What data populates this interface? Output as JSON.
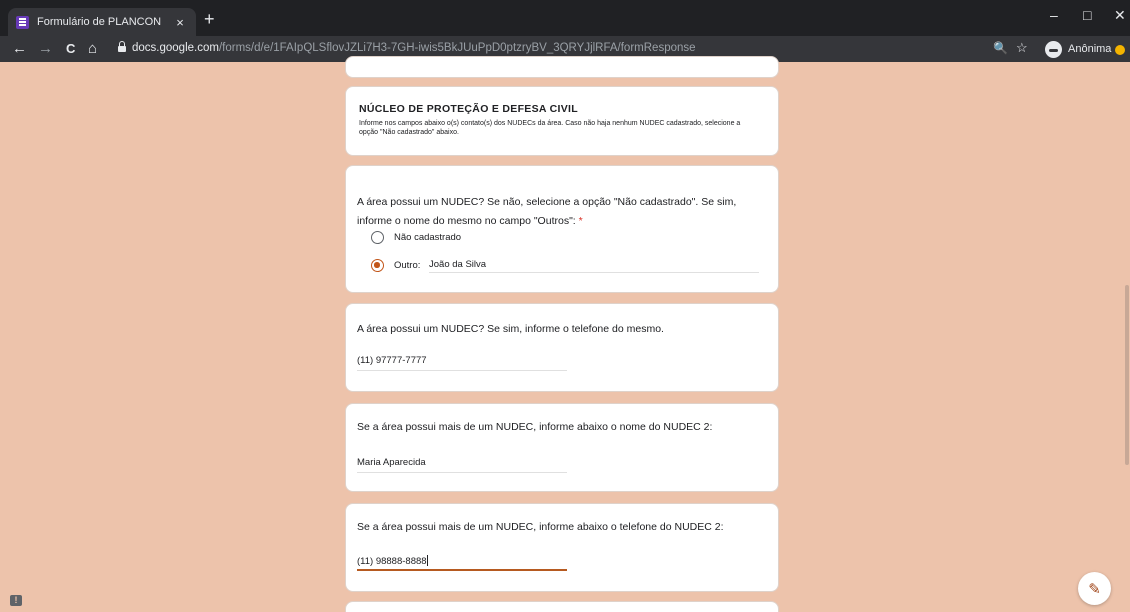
{
  "browser": {
    "tab_title": "Formulário de PLANCON",
    "tab_close": "×",
    "new_tab": "+",
    "url_host": "docs.google.com",
    "url_path": "/forms/d/e/1FAIpQLSflovJZLi7H3-7GH-iwis5BkJUuPpD0ptzryBV_3QRYJjlRFA/formResponse",
    "profile_label": "Anônima",
    "icons": {
      "back": "←",
      "forward": "→",
      "reload": "C",
      "home": "⌂",
      "zoom": "🔍",
      "star": "☆",
      "minimize": "–",
      "maximize": "□",
      "close": "✕"
    }
  },
  "form": {
    "section": {
      "title": "NÚCLEO DE PROTEÇÃO E DEFESA CIVIL",
      "description": "Informe nos campos abaixo o(s) contato(s) dos NUDECs da área. Caso não haja nenhum NUDEC cadastrado, selecione a opção \"Não cadastrado\" abaixo."
    },
    "q1": {
      "title": "A área possui um NUDEC? Se não, selecione a opção \"Não cadastrado\". Se sim, informe o nome do mesmo no campo \"Outros\":",
      "required_mark": "*",
      "option_not_registered": "Não cadastrado",
      "option_other_label": "Outro:",
      "other_value": "João da Silva",
      "selected": "other"
    },
    "q2": {
      "title": "A área possui um NUDEC? Se sim, informe o telefone do mesmo.",
      "answer": "(11) 97777-7777"
    },
    "q3": {
      "title": "Se a área possui mais de um NUDEC, informe abaixo o nome do NUDEC 2:",
      "answer": "Maria Aparecida"
    },
    "q4": {
      "title": "Se a área possui mais de um NUDEC, informe abaixo o telefone do NUDEC 2:",
      "answer": "(11) 98888-8888"
    }
  },
  "colors": {
    "page_background": "#edc3ab",
    "accent": "#c2561a",
    "required": "#d93025"
  },
  "icons": {
    "feedback": "!",
    "edit": "✎"
  }
}
